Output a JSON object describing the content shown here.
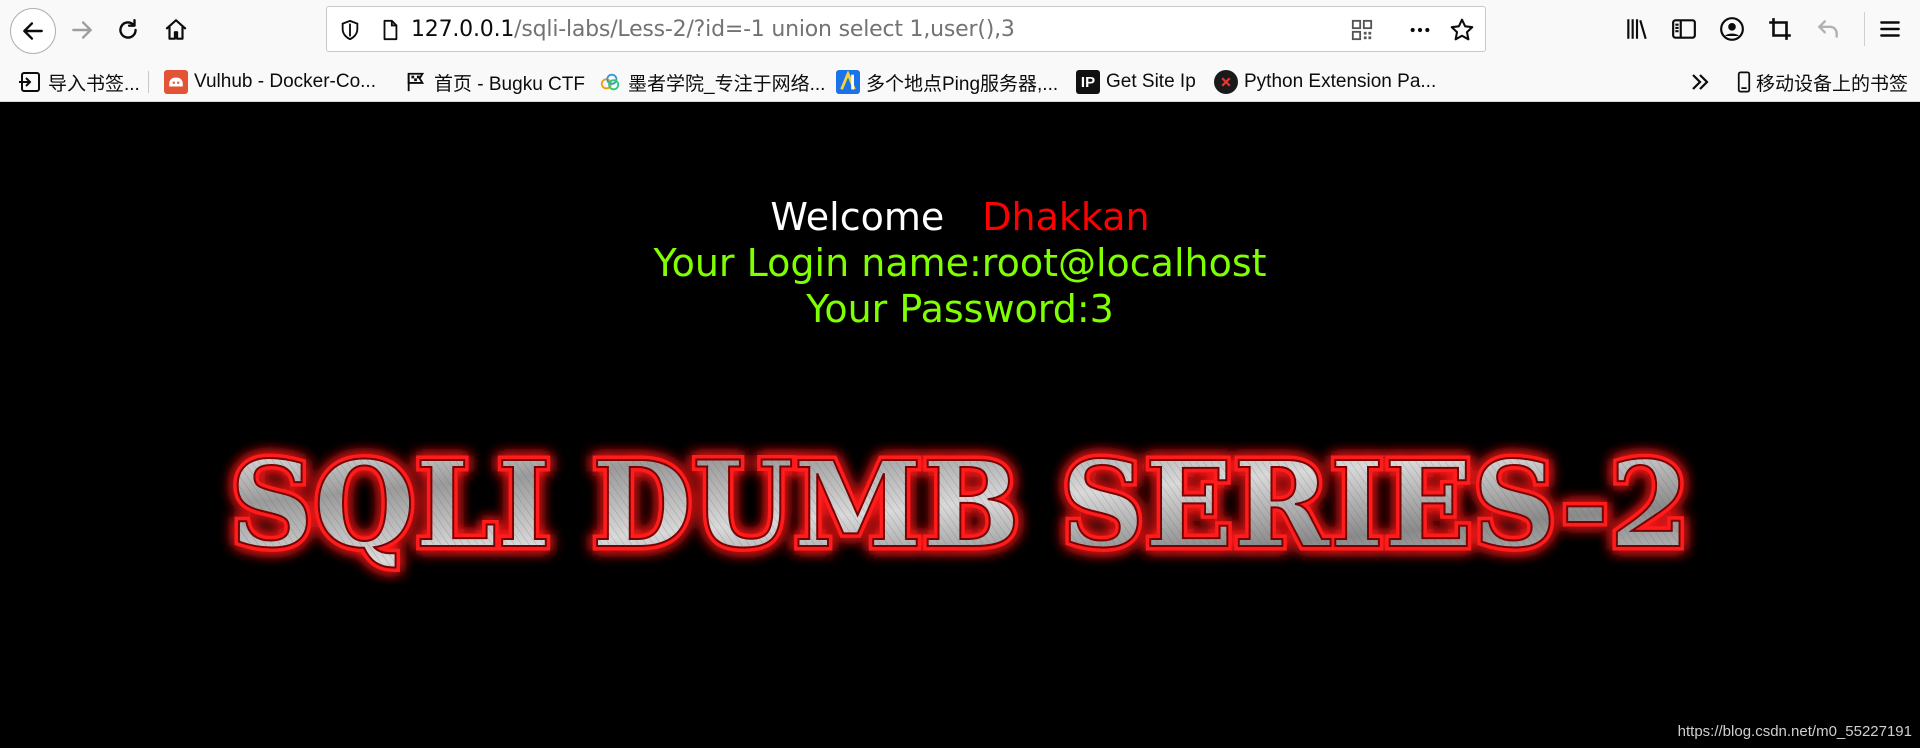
{
  "browser": {
    "url_host": "127.0.0.1",
    "url_path": "/sqli-labs/Less-2/?id=-1 union select 1,user(),3"
  },
  "bookmarks": [
    {
      "label": "导入书签...",
      "icon": "import-icon"
    },
    {
      "label": "Vulhub - Docker-Co...",
      "icon": "vulhub-icon"
    },
    {
      "label": "首页 - Bugku CTF",
      "icon": "flag-icon"
    },
    {
      "label": "墨者学院_专注于网络...",
      "icon": "cloud-icon"
    },
    {
      "label": "多个地点Ping服务器,...",
      "icon": "ping-icon"
    },
    {
      "label": "Get Site Ip",
      "icon": "ip-icon"
    },
    {
      "label": "Python Extension Pa...",
      "icon": "python-icon"
    },
    {
      "label": "移动设备上的书签",
      "icon": "mobile-icon"
    }
  ],
  "page": {
    "welcome": "Welcome",
    "name": "Dhakkan",
    "login_line": "Your Login name:root@localhost",
    "password_line": "Your Password:3",
    "banner_text": "SQLI DUMB SERIES-2",
    "watermark": "https://blog.csdn.net/m0_55227191"
  },
  "colors": {
    "background": "#000000",
    "welcome": "#ffffff",
    "name": "#ff0000",
    "info": "#7fff00",
    "banner_glow": "#ff1a1a"
  }
}
